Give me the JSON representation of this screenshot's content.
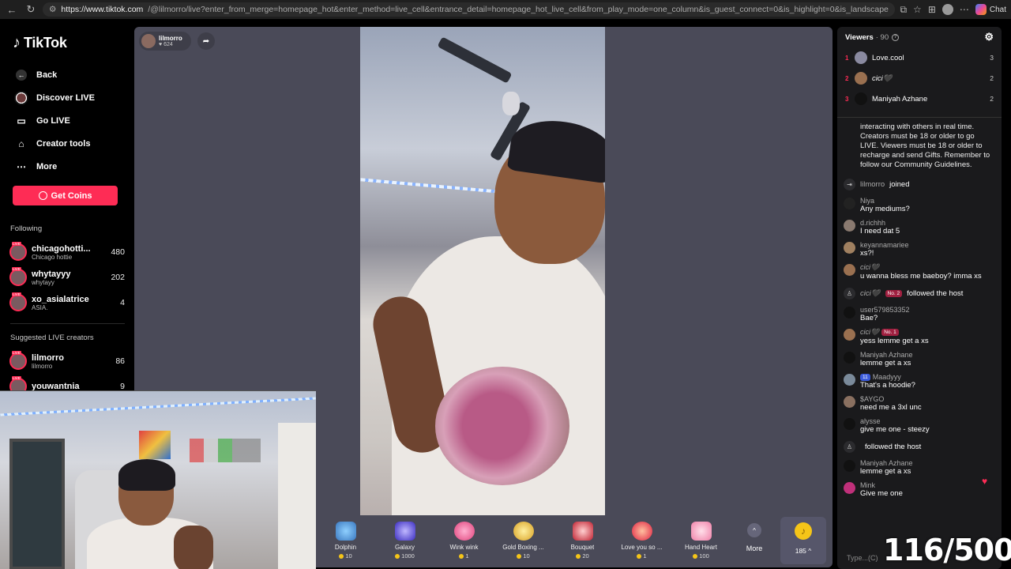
{
  "browser": {
    "url_host": "https://www.tiktok.com",
    "url_rest": "/@lilmorro/live?enter_from_merge=homepage_hot&enter_method=live_cell&entrance_detail=homepage_hot_live_cell&from_play_mode=one_column&is_guest_connect=0&is_highlight=0&is_landscape=0&request_id=20260...",
    "chat_label": "Chat"
  },
  "sidebar": {
    "logo": "TikTok",
    "nav": [
      {
        "label": "Back",
        "icon": "back-arrow-icon"
      },
      {
        "label": "Discover LIVE",
        "icon": "discover-live-icon"
      },
      {
        "label": "Go LIVE",
        "icon": "camera-icon"
      },
      {
        "label": "Creator tools",
        "icon": "home-tools-icon"
      },
      {
        "label": "More",
        "icon": "more-dots-icon"
      }
    ],
    "get_coins": "Get Coins",
    "following_title": "Following",
    "following": [
      {
        "name": "chicagohotti...",
        "sub": "Chicago hottie",
        "count": "480"
      },
      {
        "name": "whytayyy",
        "sub": "whytayy",
        "count": "202"
      },
      {
        "name": "xo_asialatrice",
        "sub": "ASIA.",
        "count": "4"
      }
    ],
    "suggested_title": "Suggested LIVE creators",
    "suggested": [
      {
        "name": "lilmorro",
        "sub": "lilmorro",
        "count": "86"
      },
      {
        "name": "youwantnia",
        "sub": "",
        "count": "9"
      }
    ],
    "live_tag": "LIVE"
  },
  "stream": {
    "host_name": "lilmorro",
    "host_likes": "624"
  },
  "gifts": [
    {
      "name": "Dolphin",
      "price": "10",
      "color": "#5aa0d8"
    },
    {
      "name": "Galaxy",
      "price": "1000",
      "color": "#6a5cff"
    },
    {
      "name": "Wink wink",
      "price": "1",
      "color": "#ff6aa0"
    },
    {
      "name": "Gold Boxing ...",
      "price": "10",
      "color": "#f0c040"
    },
    {
      "name": "Bouquet",
      "price": "20",
      "color": "#d84050"
    },
    {
      "name": "Love you so ...",
      "price": "1",
      "color": "#ff4060"
    },
    {
      "name": "Hand Heart",
      "price": "100",
      "color": "#ff9ab8"
    }
  ],
  "gift_more": "More",
  "coin_count": "185",
  "chat": {
    "viewers_label": "Viewers",
    "viewers_count": "· 90",
    "top_viewers": [
      {
        "rank": "1",
        "name": "Love.cool",
        "score": "3",
        "color": "#8a8aa0"
      },
      {
        "rank": "2",
        "name": "cici🖤",
        "score": "2",
        "color": "#9a7050"
      },
      {
        "rank": "3",
        "name": "Maniyah Azhane",
        "score": "2",
        "color": "#111111"
      }
    ],
    "notice": "interacting with others in real time. Creators must be 18 or older to go LIVE. Viewers must be 18 or older to recharge and send Gifts. Remember to follow our Community Guidelines.",
    "joined_user": "lilmorro",
    "joined_text": "joined",
    "messages": [
      {
        "user": "Niya",
        "text": "Any mediums?",
        "color": "#222222"
      },
      {
        "user": "d.richhh",
        "text": "I need dat 5",
        "color": "#8a7a70"
      },
      {
        "user": "keyannamariee",
        "text": "xs?!",
        "color": "#a08060"
      },
      {
        "user": "cici🖤",
        "text": "u wanna bless me baeboy? imma xs",
        "color": "#9a7050"
      }
    ],
    "follow_event_1": {
      "user": "cici🖤",
      "badge": "No. 2",
      "text": "followed the host"
    },
    "messages2": [
      {
        "user": "user579853352",
        "text": "Bae?",
        "color": "#111111"
      }
    ],
    "msg_badge": {
      "user": "cici🖤",
      "badge": "No. 1",
      "text": "yess lemme get a xs",
      "color": "#9a7050"
    },
    "messages3": [
      {
        "user": "Maniyah Azhane",
        "text": "lemme get a xs",
        "color": "#111111"
      }
    ],
    "msg_level": {
      "user": "Maadyyy",
      "badge": "11",
      "text": "That's a hoodie?",
      "color": "#7a8a9a"
    },
    "messages4": [
      {
        "user": "$AYGO",
        "text": "need me a 3xl unc",
        "color": "#8a7060"
      },
      {
        "user": "alysse",
        "text": "give me one - steezy",
        "color": "#111111"
      }
    ],
    "follow_event_2": {
      "user": "",
      "text": "followed the host"
    },
    "messages5": [
      {
        "user": "Maniyah Azhane",
        "text": "lemme get a xs",
        "color": "#111111"
      },
      {
        "user": "Mink",
        "text": "Give me one",
        "color": "#c0307a"
      }
    ],
    "input_placeholder": "Type...(C)"
  },
  "overlay_counter": "116/500"
}
